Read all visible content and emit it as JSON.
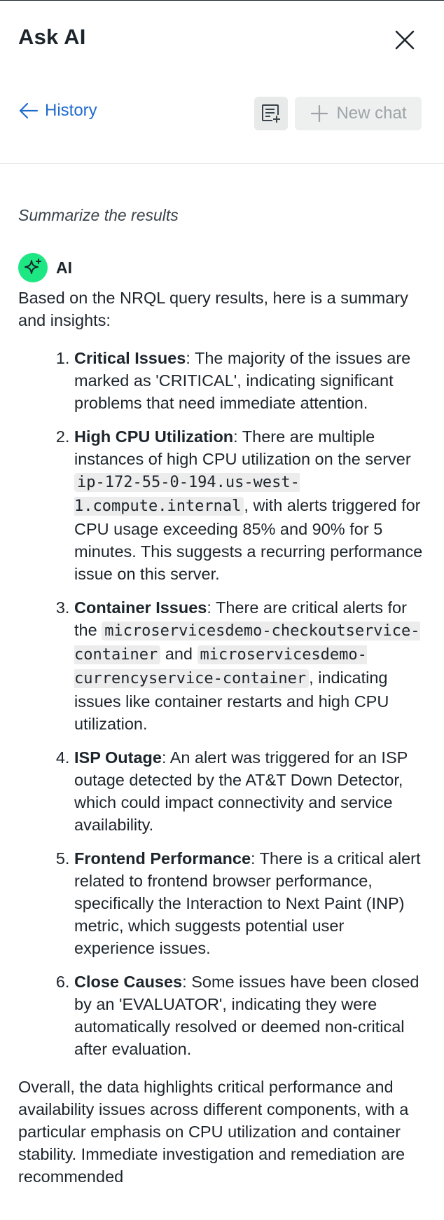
{
  "header": {
    "title": "Ask AI",
    "history_label": "History",
    "new_chat_label": "New chat"
  },
  "conversation": {
    "user_message": "Summarize the results",
    "ai_label": "AI",
    "intro": "Based on the NRQL query results, here is a summary and insights:",
    "items": [
      {
        "title": "Critical Issues",
        "text": ": The majority of the issues are marked as 'CRITICAL', indicating significant problems that need immediate attention."
      },
      {
        "title": "High CPU Utilization",
        "text_a": ": There are multiple instances of high CPU utilization on the server ",
        "code_a": "ip-172-55-0-194.us-west-1.compute.internal",
        "text_b": ", with alerts triggered for CPU usage exceeding 85% and 90% for 5 minutes. This suggests a recurring performance issue on this server."
      },
      {
        "title": "Container Issues",
        "text_a": ": There are critical alerts for the ",
        "code_a": "microservicesdemo-checkoutservice-container",
        "text_b": " and ",
        "code_b": "microservicesdemo-currencyservice-container",
        "text_c": ", indicating issues like container restarts and high CPU utilization."
      },
      {
        "title": "ISP Outage",
        "text": ": An alert was triggered for an ISP outage detected by the AT&T Down Detector, which could impact connectivity and service availability."
      },
      {
        "title": "Frontend Performance",
        "text": ": There is a critical alert related to frontend browser performance, specifically the Interaction to Next Paint (INP) metric, which suggests potential user experience issues."
      },
      {
        "title": "Close Causes",
        "text": ": Some issues have been closed by an 'EVALUATOR', indicating they were automatically resolved or deemed non-critical after evaluation."
      }
    ],
    "summary": "Overall, the data highlights critical performance and availability issues across different components, with a particular emphasis on CPU utilization and container stability. Immediate investigation and remediation are recommended"
  },
  "icons": {
    "close": "close-icon",
    "back": "arrow-left-icon",
    "notes": "notes-icon",
    "plus": "plus-icon",
    "ai": "sparkle-icon"
  },
  "colors": {
    "link": "#1f6bcd",
    "ai_avatar": "#1ce783",
    "disabled_text": "#9ea3a7"
  }
}
